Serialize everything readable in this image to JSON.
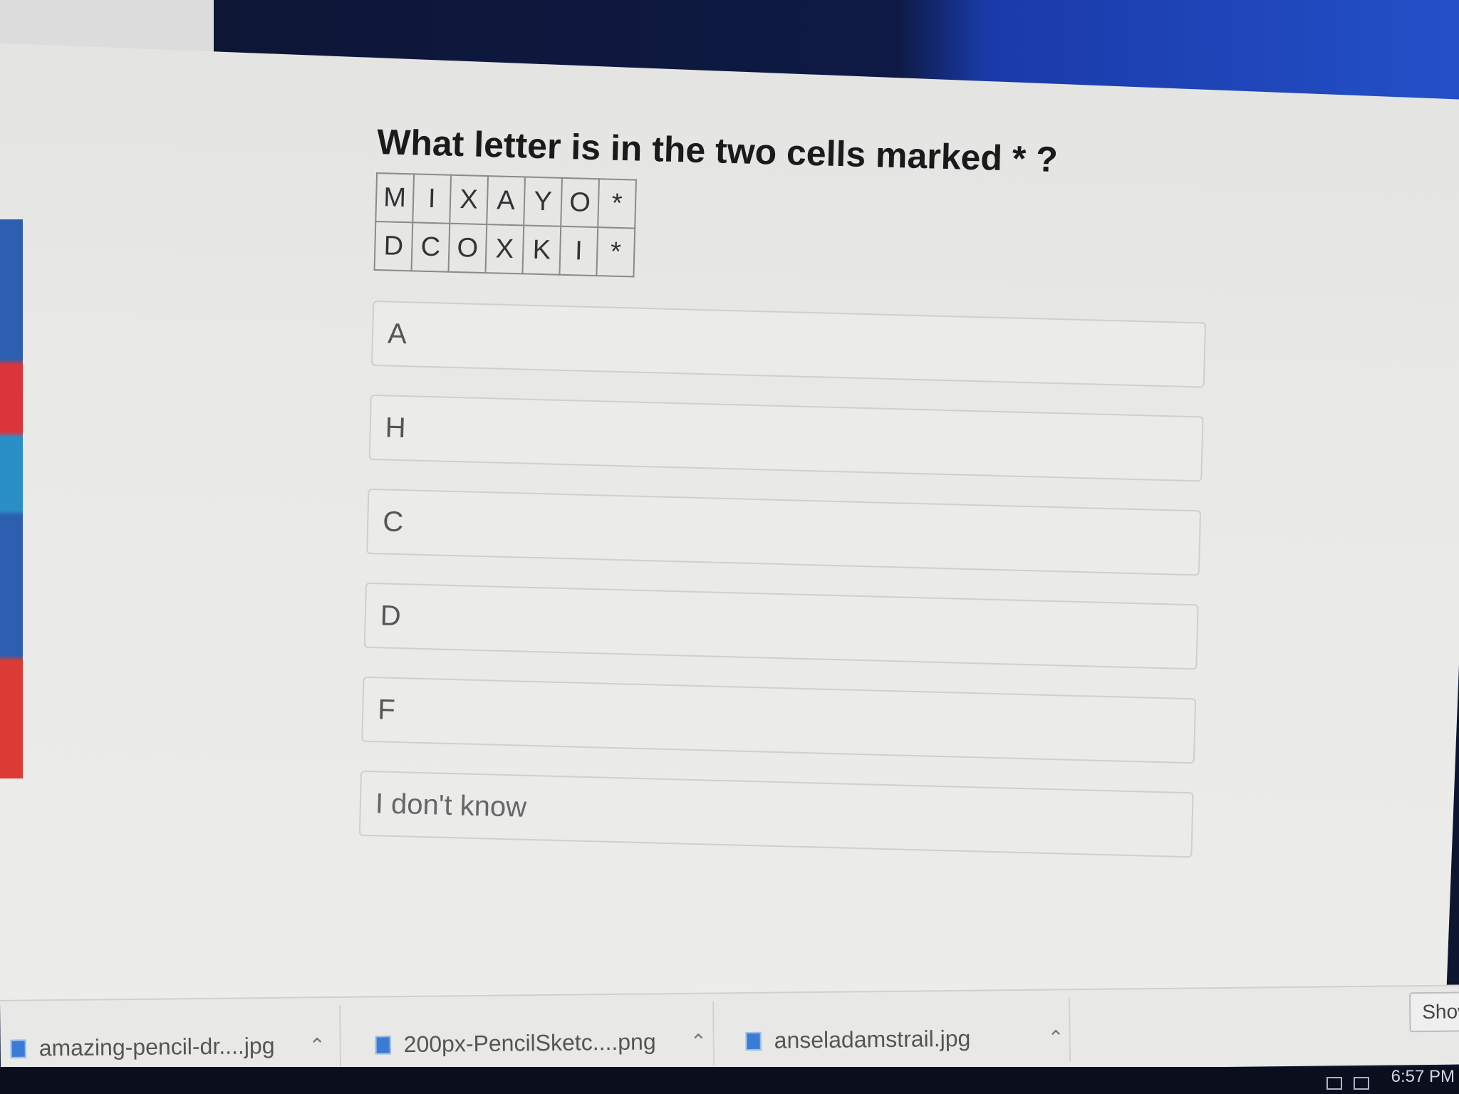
{
  "question": {
    "text": "What letter is in the two cells marked * ?"
  },
  "grid": {
    "rows": [
      [
        "M",
        "I",
        "X",
        "A",
        "Y",
        "O",
        "*"
      ],
      [
        "D",
        "C",
        "O",
        "X",
        "K",
        "I",
        "*"
      ]
    ]
  },
  "options": [
    "A",
    "H",
    "C",
    "D",
    "F",
    "I don't know"
  ],
  "downloads": {
    "items": [
      {
        "name": "amazing-pencil-dr....jpg"
      },
      {
        "name": "200px-PencilSketc....png"
      },
      {
        "name": "anseladamstrail.jpg"
      }
    ],
    "show_all_label": "Show"
  },
  "taskbar": {
    "clock": "6:57 PM"
  },
  "colors": {
    "page_background": "#e9e9e7",
    "option_border": "#cfcfcf",
    "desktop_blue": "#2350c8",
    "strip_red": "#d9353b"
  }
}
